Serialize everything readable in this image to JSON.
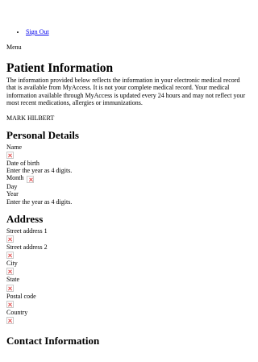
{
  "nav": {
    "sign_out": "Sign Out"
  },
  "menu_label": "Menu",
  "page_title": "Patient Information",
  "intro": "The information provided below reflects the information in your electronic medical record that is available from MyAccess. It is not your complete medical record. Your medical information available through MyAccess is updated every 24 hours and may not reflect your most recent medications, allergies or immunizations.",
  "patient_name": "MARK HILBERT",
  "personal": {
    "heading": "Personal Details",
    "name_label": "Name",
    "dob_label": "Date of birth",
    "year_hint_1": "Enter the year as 4 digits.",
    "month_label": "Month",
    "day_label": "Day",
    "year_label": "Year",
    "year_hint_2": "Enter the year as 4 digits."
  },
  "address": {
    "heading": "Address",
    "street1": "Street address 1",
    "street2": "Street address 2",
    "city": "City",
    "state": "State",
    "postal": "Postal code",
    "country": "Country"
  },
  "contact": {
    "heading": "Contact Information"
  }
}
